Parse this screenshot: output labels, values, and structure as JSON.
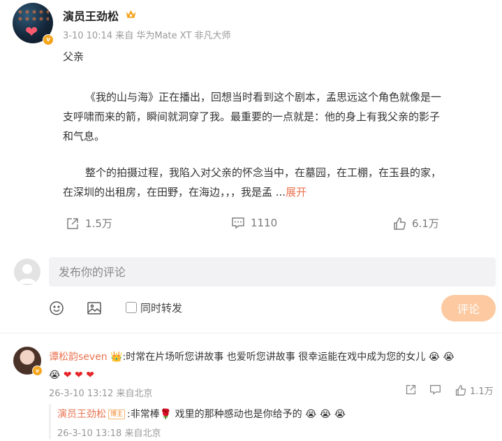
{
  "post": {
    "author": "演员王劲松",
    "meta": "3-10 10:14 来自 华为Mate XT 非凡大师",
    "lines": [
      "父亲",
      "《我的山与海》正在播出，回想当时看到这个剧本，孟思远这个角色就像是一",
      "支呼啸而来的箭，瞬间就洞穿了我。最重要的一点就是：他的身上有我父亲的影子",
      "和气息。",
      "整个的拍摄过程，我陷入对父亲的怀念当中，在墓园，在工棚，在玉县的家，",
      "在深圳的出租房，在田野，在海边，，，我是孟 ..."
    ],
    "expand_label": "展开",
    "reposts": "1.5万",
    "comments": "1110",
    "likes": "6.1万"
  },
  "composer": {
    "placeholder": "发布你的评论",
    "forward_label": "同时转发",
    "submit_label": "评论"
  },
  "comments": [
    {
      "user": "谭松韵seven",
      "text": ":时常在片场听您讲故事 也爱听您讲故事 很幸运能在戏中成为您的女儿",
      "meta": "26-3-10 13:12 来自北京",
      "likes": "1.1万",
      "reply": {
        "user": "演员王劲松",
        "tag": "博主",
        "text_before": ":非常棒",
        "text_after": " 戏里的那种感动也是你给予的",
        "meta": "26-3-10 13:18 来自北京"
      }
    }
  ],
  "icons": {
    "verified": "verified-badge-icon",
    "crown": "crown-icon",
    "repost": "repost-icon",
    "comment": "comment-icon",
    "like": "like-icon",
    "emoji": "emoji-icon",
    "image": "image-icon",
    "tear_emoji": "crying-face-emoji",
    "heart_emoji": "red-heart-emoji",
    "rose_emoji": "rose-emoji"
  },
  "colors": {
    "accent": "#eb7350",
    "submit_bg": "#fcc9a1",
    "verified": "#f4a51c"
  }
}
